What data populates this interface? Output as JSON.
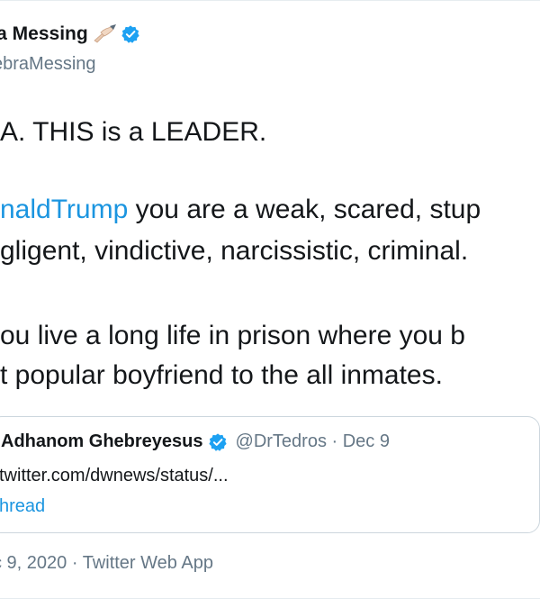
{
  "author": {
    "display_name": "ra Messing",
    "handle": "ebraMessing"
  },
  "tweet": {
    "lines": [
      "A.   THIS is a LEADER.",
      "",
      "gligent, vindictive, narcissistic, criminal.",
      "",
      "ou live a long life in prison where you b",
      "t popular boyfriend to the all inmates."
    ],
    "mention": "naldTrump",
    "mention_rest": " you are a weak, scared, stup"
  },
  "quoted_tweet": {
    "author_name": "Adhanom Ghebreyesus",
    "meta": "@DrTedros · Dec 9",
    "link_text": "twitter.com/dwnews/status/...",
    "thread_label": "hread"
  },
  "timestamp": "c 9, 2020 · Twitter Web App",
  "colors": {
    "link": "#1b95e0",
    "secondary_text": "#657786",
    "verified": "#1da1f2",
    "border": "#ccd6dd"
  },
  "icons": {
    "pen": "writing-hand-emoji",
    "verified": "verified-badge-icon"
  }
}
